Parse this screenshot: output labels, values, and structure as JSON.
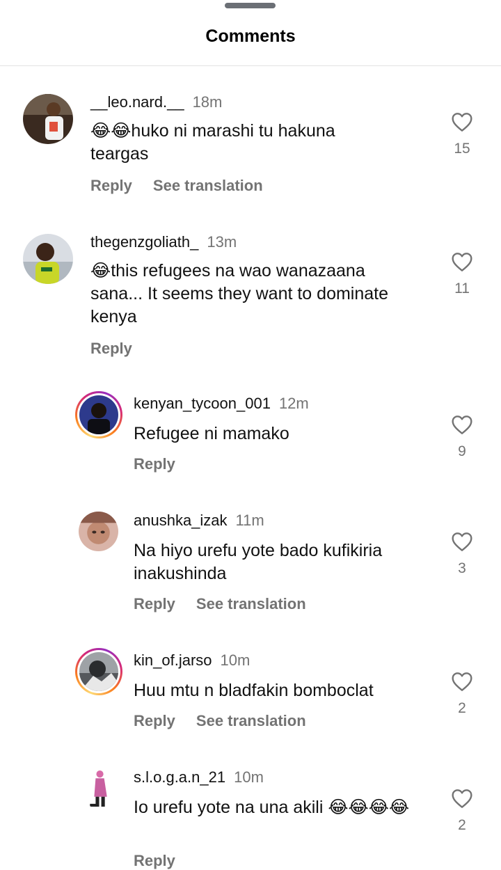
{
  "header": {
    "title": "Comments"
  },
  "comments": [
    {
      "username": "__leo.nard.__",
      "time": "18m",
      "text": "😂😂huko ni marashi tu hakuna teargas",
      "likes": "15",
      "actions": [
        "Reply",
        "See translation"
      ]
    },
    {
      "username": "thegenzgoliath_",
      "time": "13m",
      "text": "😂this refugees na wao wanazaana sana... It seems they want to dominate kenya",
      "likes": "11",
      "actions": [
        "Reply"
      ]
    },
    {
      "username": "kenyan_tycoon_001",
      "time": "12m",
      "text": "Refugee ni mamako",
      "likes": "9",
      "actions": [
        "Reply"
      ]
    },
    {
      "username": "anushka_izak",
      "time": "11m",
      "text": "Na hiyo urefu yote bado kufikiria inakushinda",
      "likes": "3",
      "actions": [
        "Reply",
        "See translation"
      ]
    },
    {
      "username": "kin_of.jarso",
      "time": "10m",
      "text": "Huu mtu n bladfakin bomboclat",
      "likes": "2",
      "actions": [
        "Reply",
        "See translation"
      ]
    },
    {
      "username": "s.l.o.g.a.n_21",
      "time": "10m",
      "text": "Io urefu yote na una akili 😂😂😂😂",
      "likes": "2",
      "actions": [
        "Reply"
      ]
    }
  ],
  "icons": {
    "like": "heart-outline-icon"
  },
  "colors": {
    "muted": "#737373",
    "story_ring": [
      "#feda75",
      "#fa7e1e",
      "#d62976",
      "#962fbf"
    ]
  }
}
